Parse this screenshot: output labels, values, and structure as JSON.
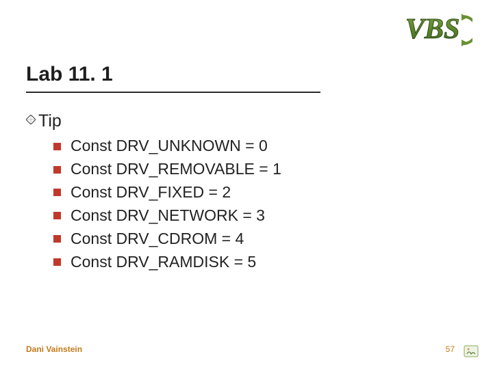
{
  "slide": {
    "title": "Lab 11. 1",
    "logo_text": "VBS",
    "tip_label": "Tip",
    "items": [
      "Const DRV_UNKNOWN = 0",
      "Const DRV_REMOVABLE = 1",
      "Const DRV_FIXED = 2",
      "Const DRV_NETWORK = 3",
      "Const DRV_CDROM = 4",
      "Const DRV_RAMDISK = 5"
    ],
    "footer_author": "Dani Vainstein",
    "page_number": "57"
  },
  "colors": {
    "bullet2": "#c0392b",
    "footer": "#c47a1a"
  }
}
